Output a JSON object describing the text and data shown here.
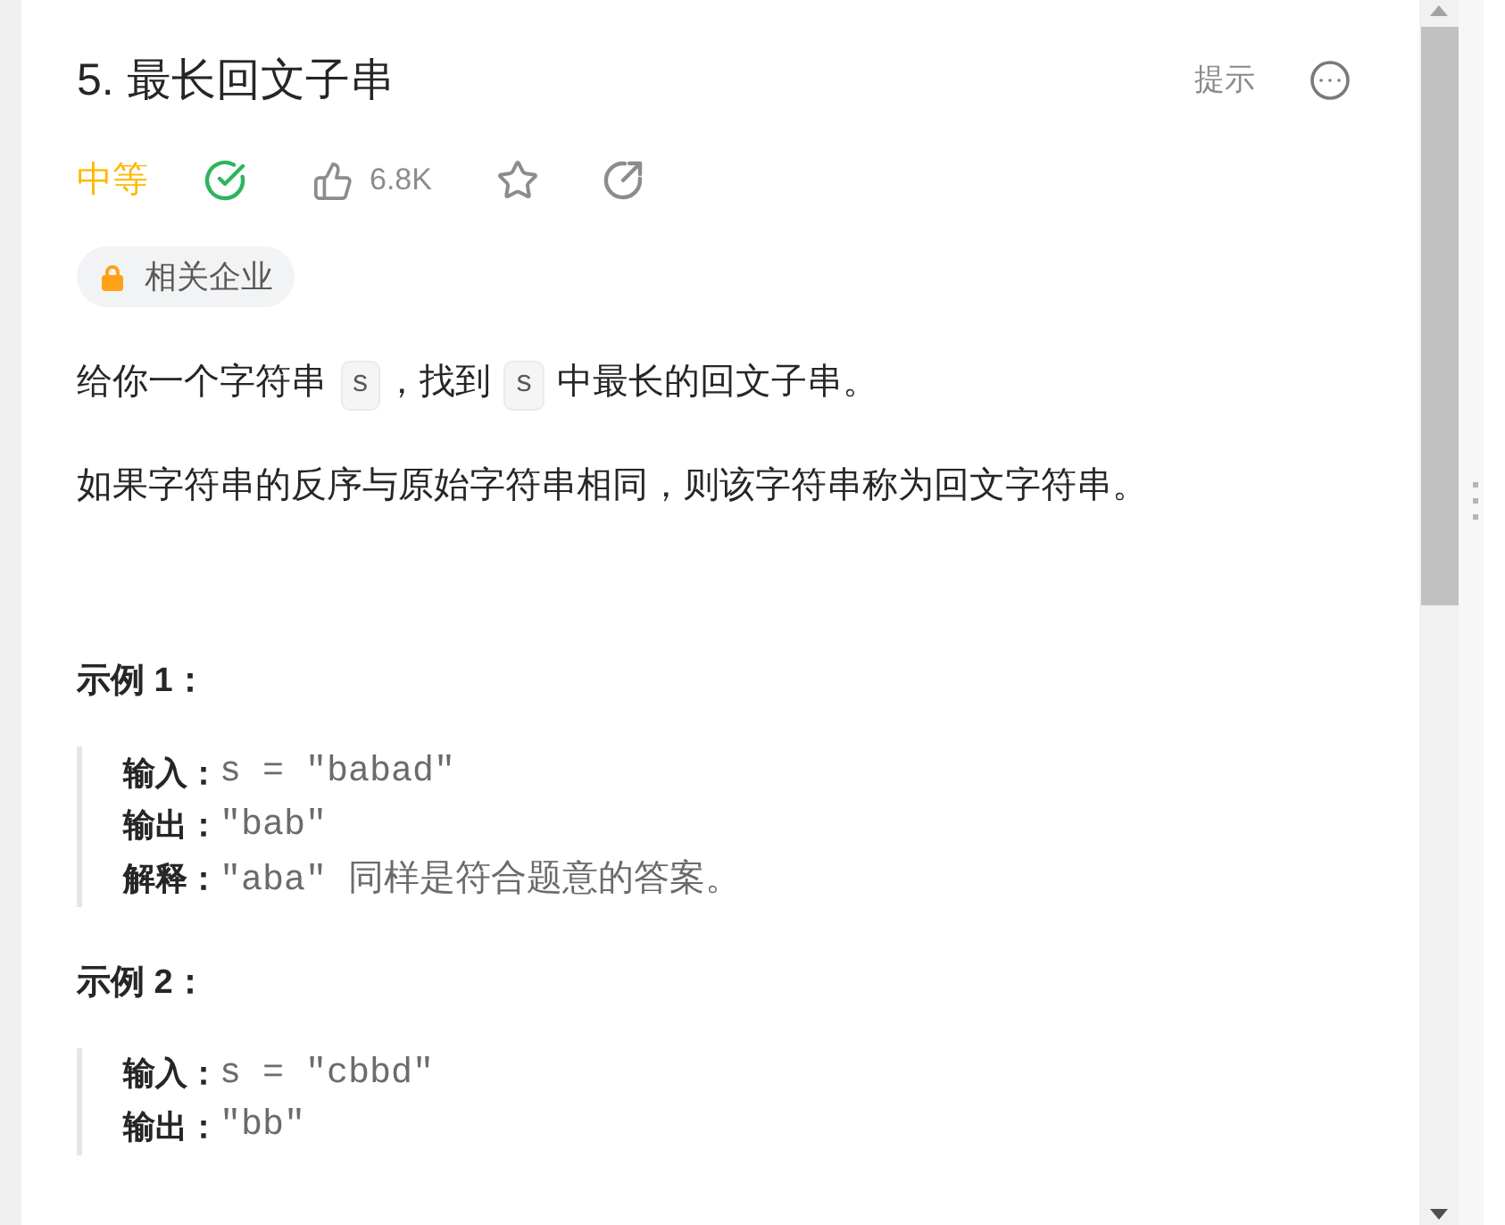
{
  "header": {
    "title": "5. 最长回文子串",
    "hint": "提示"
  },
  "meta": {
    "difficulty": "中等",
    "solved": true,
    "likes": "6.8K"
  },
  "tag": {
    "label": "相关企业"
  },
  "description": [
    {
      "segments": [
        {
          "kind": "text",
          "text": "给你一个字符串 "
        },
        {
          "kind": "code",
          "text": "s"
        },
        {
          "kind": "text",
          "text": "，找到 "
        },
        {
          "kind": "code",
          "text": "s"
        },
        {
          "kind": "text",
          "text": " 中最长的回文子串。"
        }
      ]
    },
    {
      "segments": [
        {
          "kind": "text",
          "text": "如果字符串的反序与原始字符串相同，则该字符串称为回文字符串。"
        }
      ]
    }
  ],
  "examples": [
    {
      "heading": "示例 1：",
      "lines": [
        {
          "label": "输入：",
          "value": "s = \"babad\""
        },
        {
          "label": "输出：",
          "value": "\"bab\""
        },
        {
          "label": "解释：",
          "value": "\"aba\" 同样是符合题意的答案。"
        }
      ]
    },
    {
      "heading": "示例 2：",
      "lines": [
        {
          "label": "输入：",
          "value": "s = \"cbbd\""
        },
        {
          "label": "输出：",
          "value": "\"bb\""
        }
      ]
    }
  ]
}
